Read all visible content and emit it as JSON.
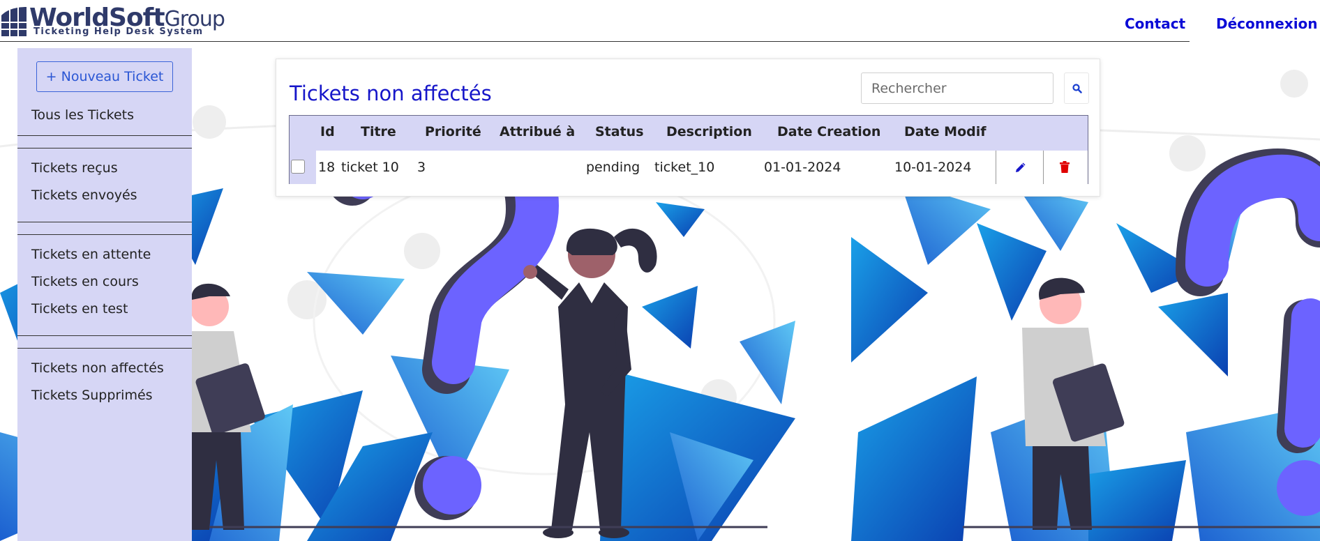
{
  "header": {
    "logo_name_bold": "WorldSoft",
    "logo_name_light": "Group",
    "logo_tagline": "Ticketing Help Desk System",
    "nav": {
      "contact": "Contact",
      "logout": "Déconnexion"
    }
  },
  "sidebar": {
    "new_ticket": "+ Nouveau Ticket",
    "items": [
      {
        "label": "Tous les Tickets"
      },
      {
        "label": "Tickets reçus"
      },
      {
        "label": "Tickets envoyés"
      },
      {
        "label": "Tickets en attente"
      },
      {
        "label": "Tickets en cours"
      },
      {
        "label": "Tickets en test"
      },
      {
        "label": "Tickets non affectés"
      },
      {
        "label": "Tickets Supprimés"
      }
    ]
  },
  "main": {
    "title": "Tickets non affectés",
    "search": {
      "placeholder": "Rechercher"
    },
    "table": {
      "columns": [
        "Id",
        "Titre",
        "Priorité",
        "Attribué à",
        "Status",
        "Description",
        "Date Creation",
        "Date Modif"
      ],
      "rows": [
        {
          "id": "18",
          "titre": "ticket 10",
          "priorite": "3",
          "attribue": "",
          "status": "pending",
          "description": "ticket_10",
          "date_creation": "01-01-2024",
          "date_modif": "10-01-2024"
        }
      ]
    }
  },
  "icons": {
    "search": "search-icon",
    "edit": "pencil-icon",
    "delete": "trash-icon"
  },
  "colors": {
    "accent_blue": "#1616c9",
    "nav_blue": "#0b0bd6",
    "sidebar_bg": "#d6d6f5",
    "delete_red": "#e00000",
    "illustration_purple": "#6c63ff"
  }
}
